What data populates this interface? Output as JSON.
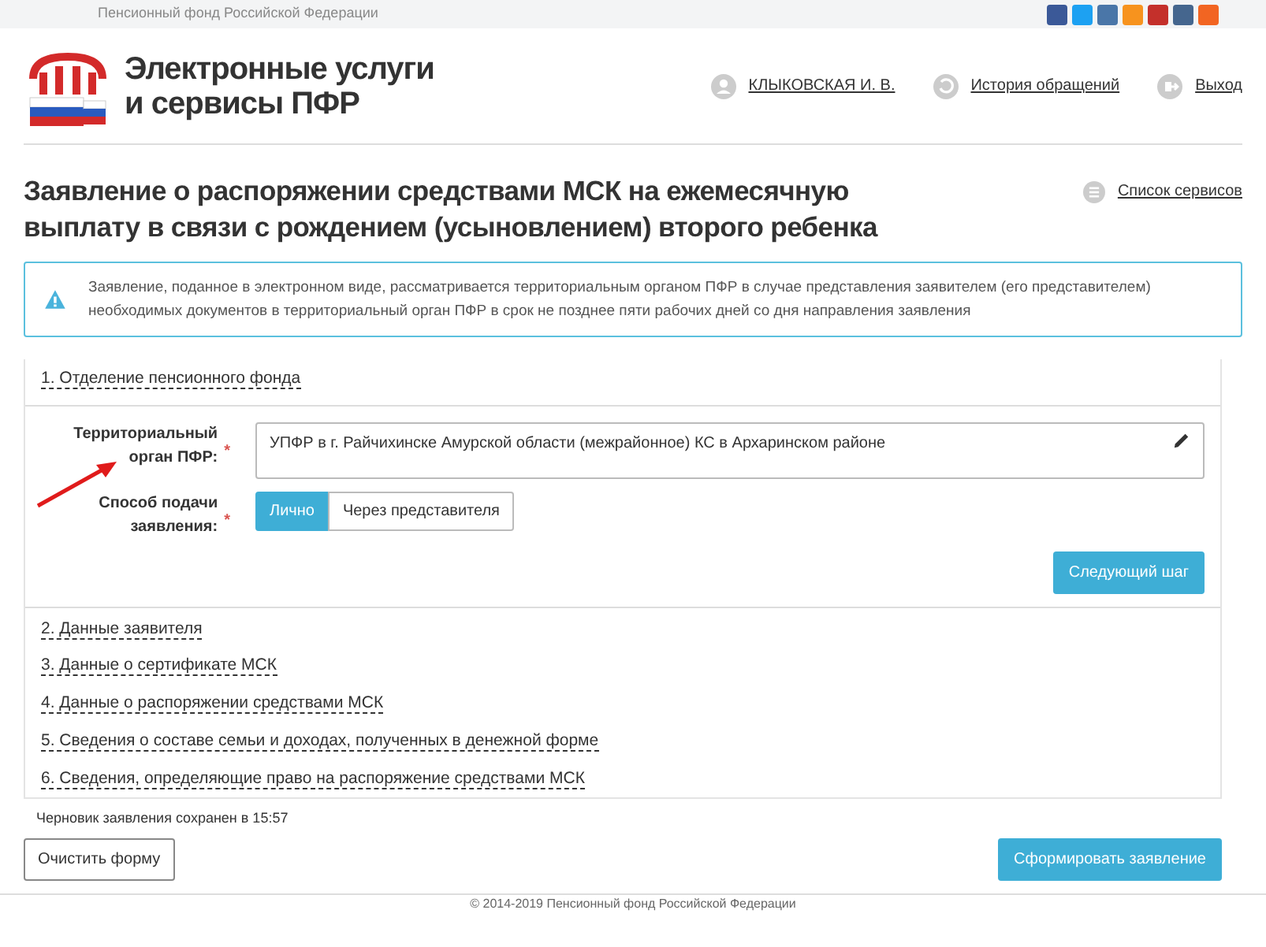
{
  "top_bar": {
    "text": "Пенсионный фонд Российской Федерации"
  },
  "header": {
    "logo_text": [
      "Электронные услуги",
      "и сервисы ПФР"
    ],
    "nav": [
      {
        "kind": "user",
        "label": "КЛЫКОВСКАЯ И. В."
      },
      {
        "kind": "history",
        "label": "История обращений"
      },
      {
        "kind": "exit",
        "label": "Выход"
      }
    ]
  },
  "page_title": "Заявление о распоряжении средствами МСК на ежемесячную выплату в связи с рождением (усыновлением) второго ребенка",
  "services_link": "Список сервисов",
  "alert": "Заявление, поданное в электронном виде, рассматривается территориальным органом ПФР в случае представления заявителем (его представителем) необходимых документов в территориальный орган ПФР в срок не позднее пяти рабочих дней со дня направления заявления",
  "steps": [
    {
      "label": "1. Отделение пенсионного фонда",
      "form": {
        "fields": [
          {
            "kind": "text",
            "label": "Территориальный орган ПФР:",
            "required_mark": "*",
            "value": "УПФР в г. Райчихинске Амурской области (межрайонное) КС в Архаринском районе"
          },
          {
            "kind": "choice",
            "label": "Способ подачи заявления:",
            "required_mark": "*",
            "options": [
              {
                "label": "Лично",
                "selected": true
              },
              {
                "label": "Через представителя",
                "selected": false
              }
            ]
          }
        ],
        "next_button": "Следующий шаг"
      }
    },
    {
      "label": "2. Данные заявителя"
    },
    {
      "label": "3. Данные о сертификате МСК"
    },
    {
      "label": "4. Данные о распоряжении средствами МСК"
    },
    {
      "label": "5. Сведения о составе семьи и доходах, полученных в денежной форме"
    },
    {
      "label": "6. Сведения, определяющие право на распоряжение средствами МСК"
    }
  ],
  "draft_note": "Черновик заявления сохранен в 15:57",
  "clear_button": "Очистить форму",
  "submit_button": "Сформировать заявление",
  "footer": "© 2014-2019 Пенсионный фонд Российской Федерации"
}
